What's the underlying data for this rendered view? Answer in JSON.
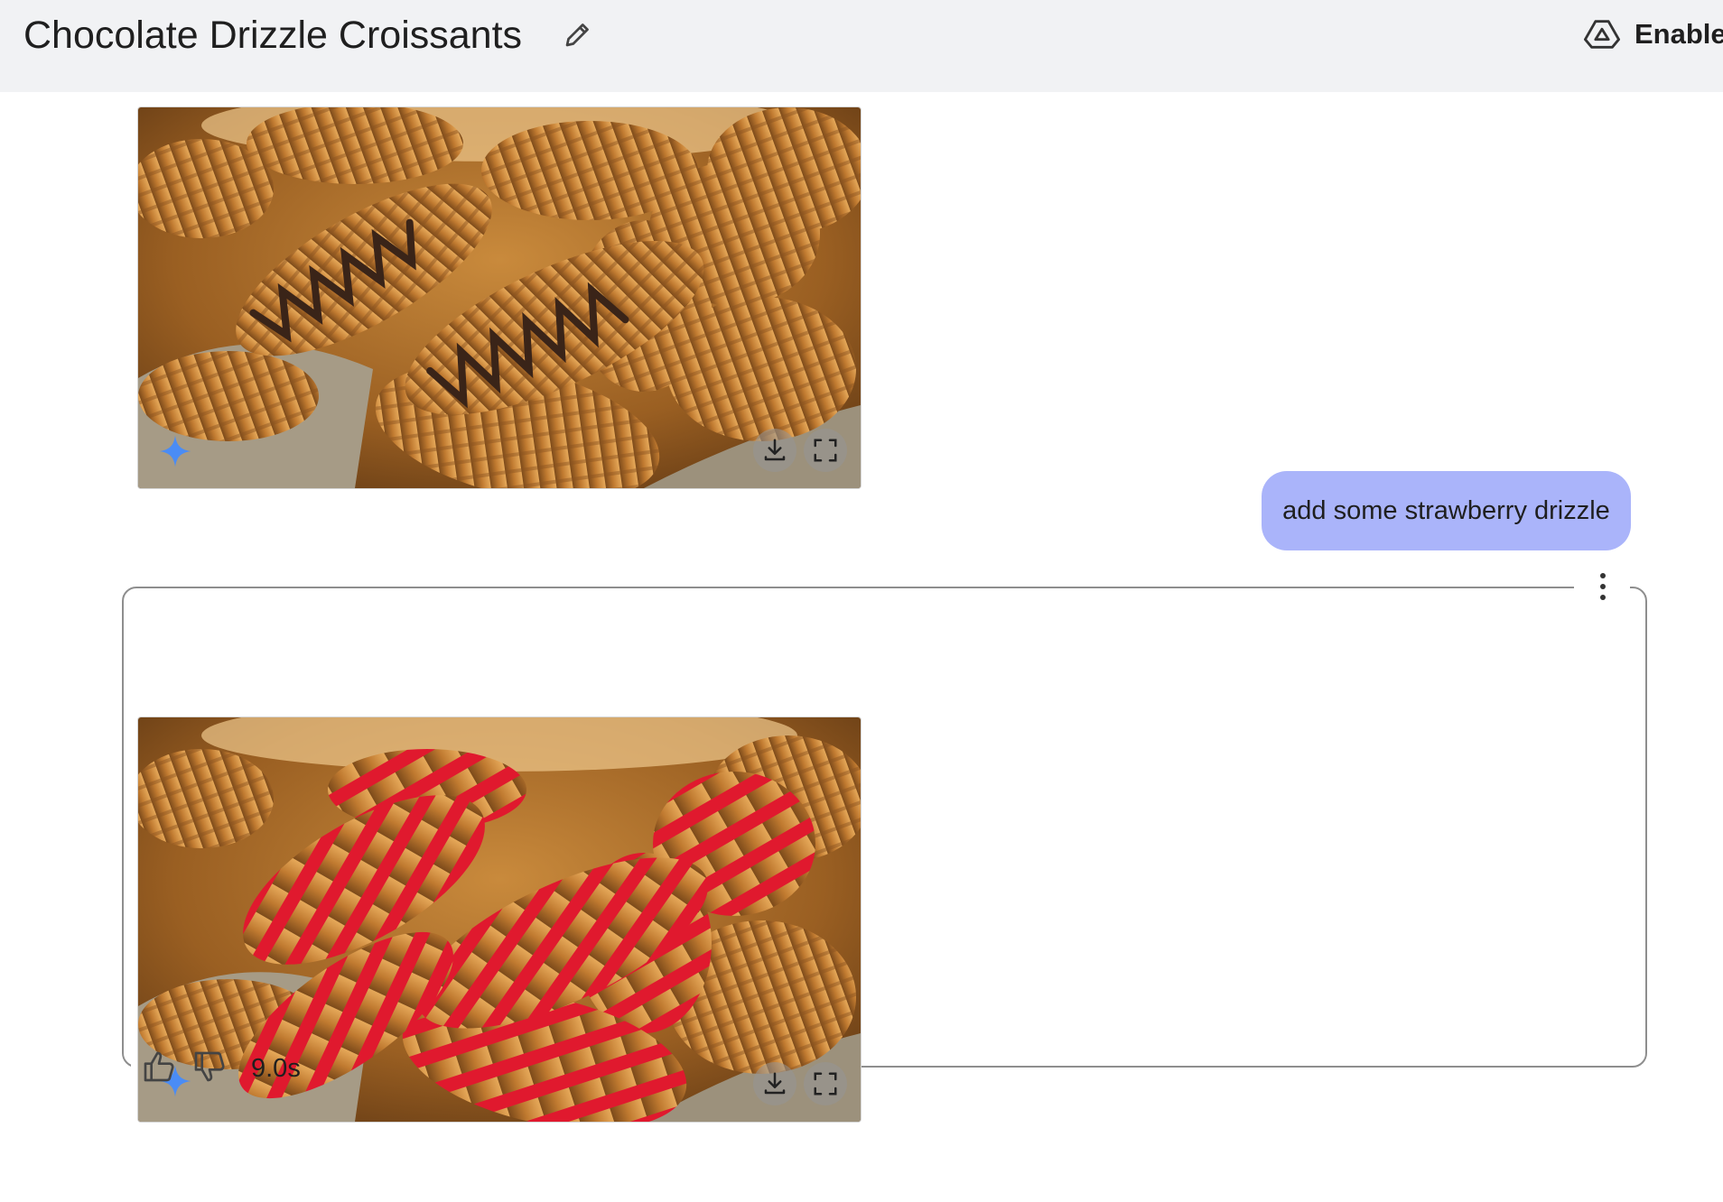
{
  "header": {
    "title": "Chocolate Drizzle Croissants",
    "edit_icon": "pencil-icon",
    "enable_icon": "drive-icon",
    "enable_label": "Enable"
  },
  "images": [
    {
      "name": "chocolate-drizzle-croissants",
      "drizzle_color": "#3a2418",
      "sparkle_icon": "sparkle-icon",
      "download_icon": "download-icon",
      "fullscreen_icon": "fullscreen-icon"
    },
    {
      "name": "strawberry-drizzle-croissants",
      "drizzle_color": "#e0192e",
      "sparkle_icon": "sparkle-icon",
      "download_icon": "download-icon",
      "fullscreen_icon": "fullscreen-icon"
    }
  ],
  "user_message": {
    "text": "add some strawberry drizzle"
  },
  "response": {
    "more_icon": "more-vert-icon",
    "thumbs_up_icon": "thumbs-up-icon",
    "thumbs_down_icon": "thumbs-down-icon",
    "duration": "9.0s"
  },
  "colors": {
    "header_bg": "#f1f2f4",
    "bubble_bg": "#aab4fa",
    "sparkle": "#4a8cf5"
  }
}
